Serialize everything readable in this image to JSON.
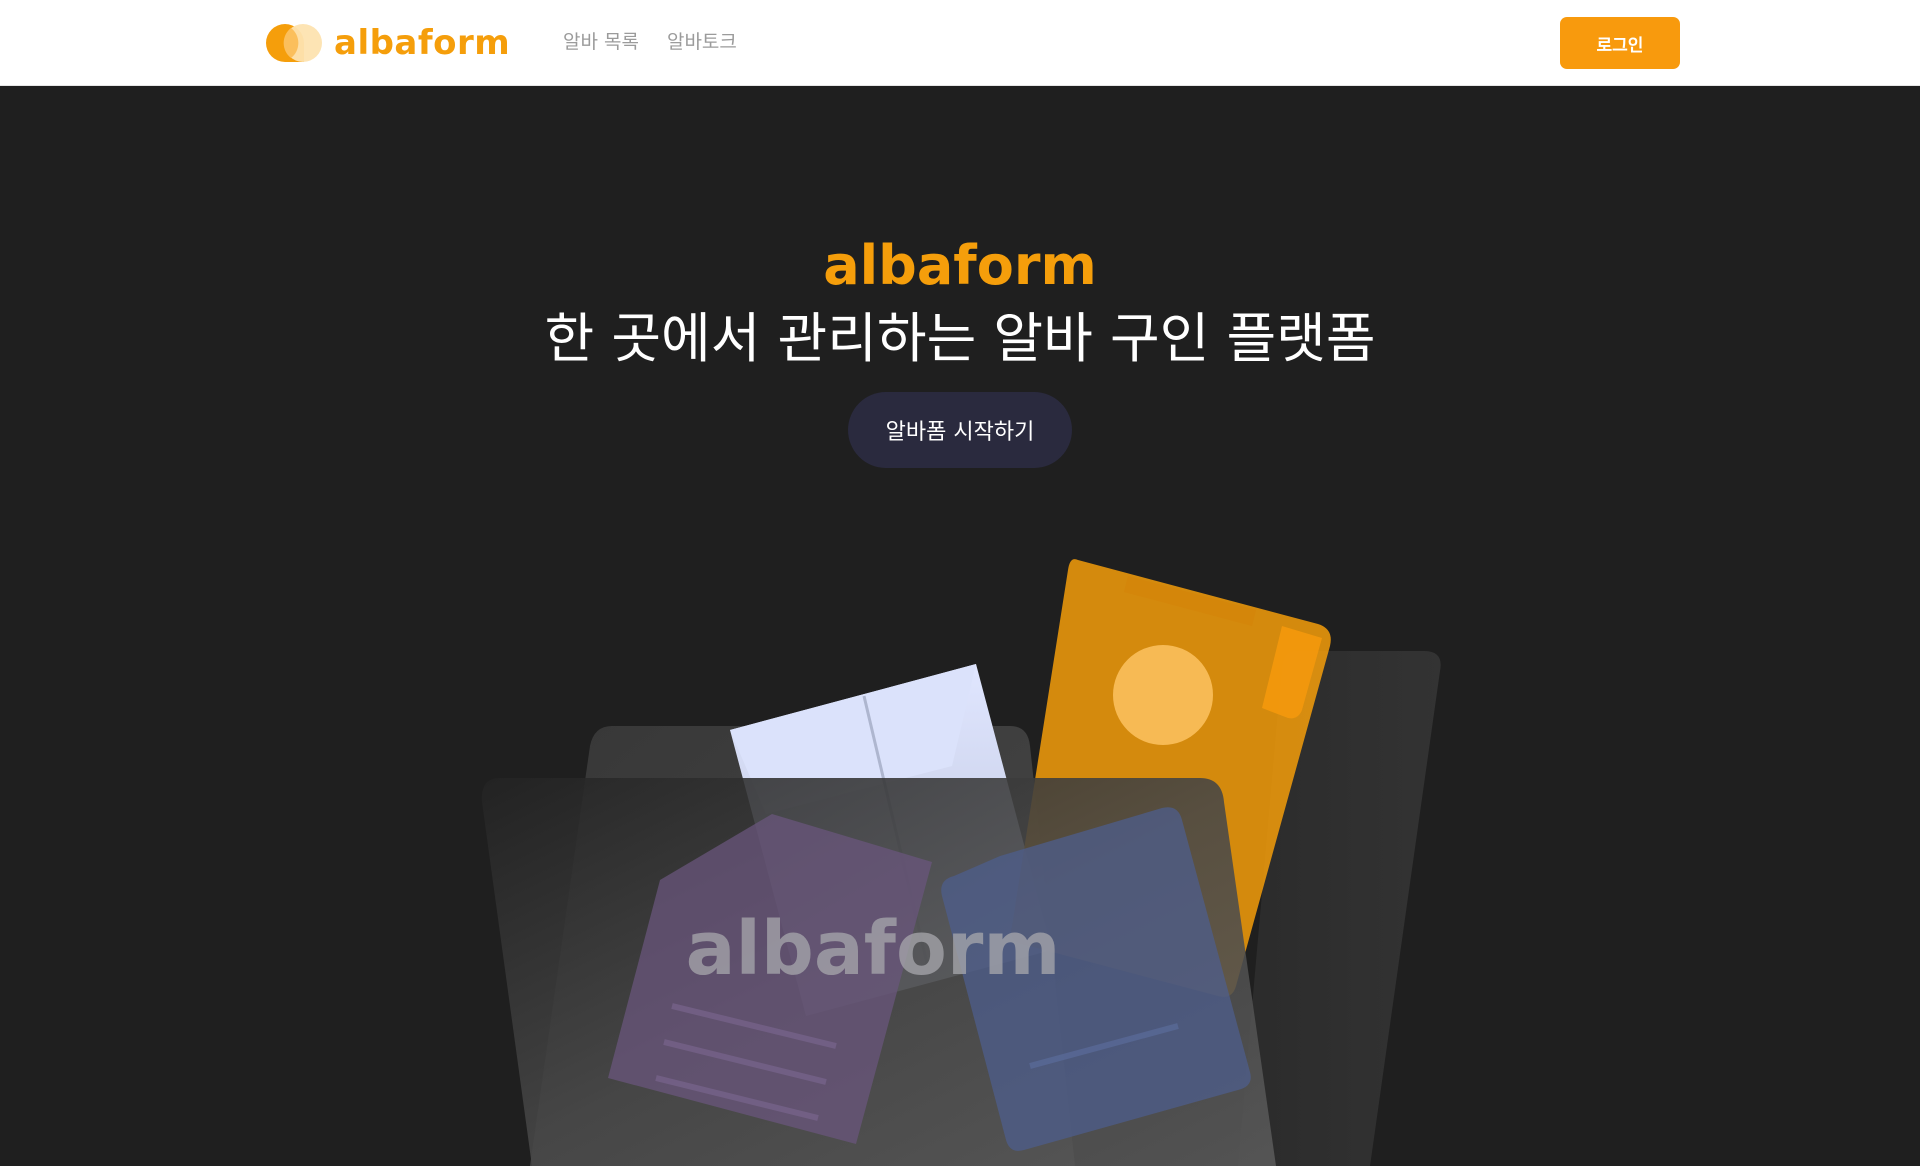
{
  "header": {
    "logo_text": "albaform",
    "nav": [
      {
        "label": "알바 목록"
      },
      {
        "label": "알바토크"
      }
    ],
    "login_label": "로그인"
  },
  "hero": {
    "brand": "albaform",
    "title": "한 곳에서 관리하는 알바 구인 플랫폼",
    "cta_label": "알바폼 시작하기",
    "illustration_text": "albaform"
  },
  "colors": {
    "brand_orange": "#f59e0b",
    "login_button": "#f89a0d",
    "hero_background": "#1f1f1f",
    "cta_background": "#2a2a3e",
    "nav_text": "#9b9b9b"
  },
  "icons": {
    "logo": "albaform-logo-icon"
  }
}
